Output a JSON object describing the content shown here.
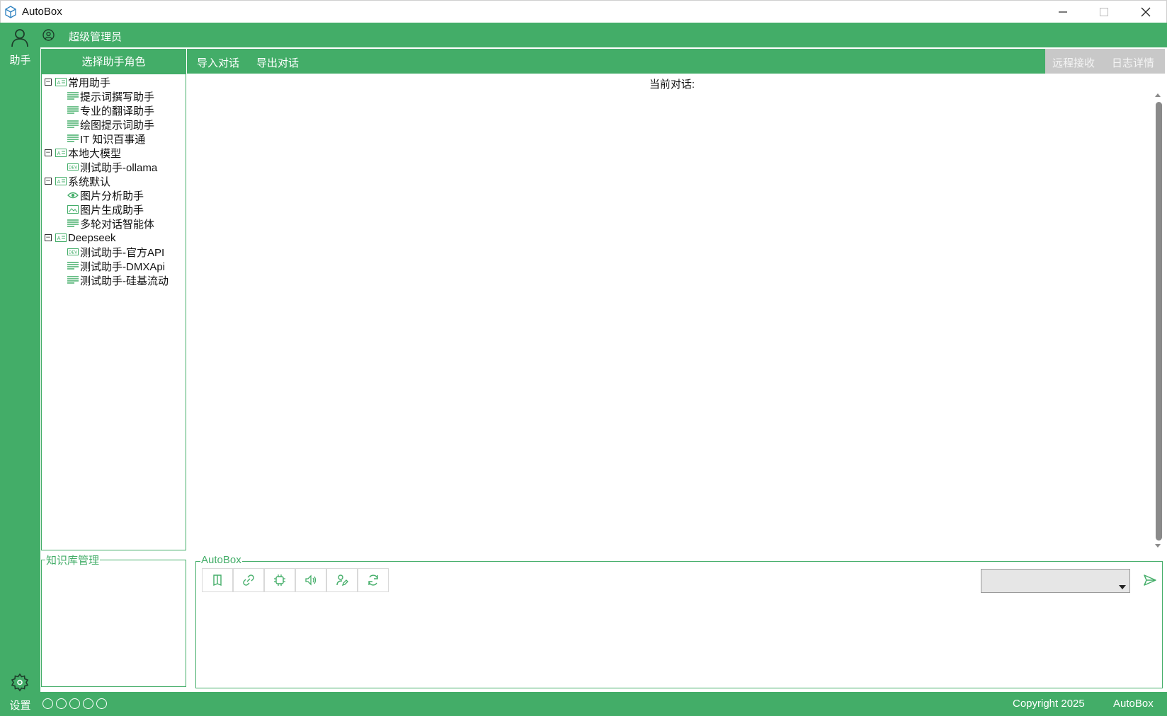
{
  "window": {
    "title": "AutoBox"
  },
  "rail": {
    "assistant_label": "助手",
    "settings_label": "设置"
  },
  "user": {
    "name": "超级管理员"
  },
  "role_panel": {
    "header": "选择助手角色",
    "groups": [
      {
        "label": "常用助手",
        "toggle": "⊟",
        "items": [
          {
            "label": "提示词撰写助手",
            "icon": "lines-icon"
          },
          {
            "label": "专业的翻译助手",
            "icon": "lines-icon"
          },
          {
            "label": "绘图提示词助手",
            "icon": "lines-icon"
          },
          {
            "label": "IT 知识百事通",
            "icon": "lines-icon"
          }
        ]
      },
      {
        "label": "本地大模型",
        "toggle": "⊟",
        "items": [
          {
            "label": "测试助手-ollama",
            "icon": "dev-icon"
          }
        ]
      },
      {
        "label": "系统默认",
        "toggle": "⊟",
        "items": [
          {
            "label": "图片分析助手",
            "icon": "eye-icon"
          },
          {
            "label": "图片生成助手",
            "icon": "image-icon"
          },
          {
            "label": "多轮对话智能体",
            "icon": "lines-icon"
          }
        ]
      },
      {
        "label": "Deepseek",
        "toggle": "⊟",
        "items": [
          {
            "label": "测试助手-官方API",
            "icon": "dev-icon"
          },
          {
            "label": "测试助手-DMXApi",
            "icon": "lines-icon"
          },
          {
            "label": "测试助手-硅基流动",
            "icon": "lines-icon"
          }
        ]
      }
    ]
  },
  "knowledge_panel": {
    "title": "知识库管理"
  },
  "chat_toolbar": {
    "import_label": "导入对话",
    "export_label": "导出对话",
    "remote_label": "远程接收",
    "log_label": "日志详情"
  },
  "conversation": {
    "title": "当前对话:"
  },
  "input_group": {
    "title": "AutoBox",
    "tools": [
      "book-icon",
      "link-icon",
      "chip-icon",
      "speaker-icon",
      "user-edit-icon",
      "refresh-icon"
    ],
    "model_select_value": ""
  },
  "status": {
    "copyright": "Copyright  2025",
    "brand": "AutoBox"
  },
  "colors": {
    "accent": "#43ad68",
    "gray": "#c8c8c8"
  }
}
